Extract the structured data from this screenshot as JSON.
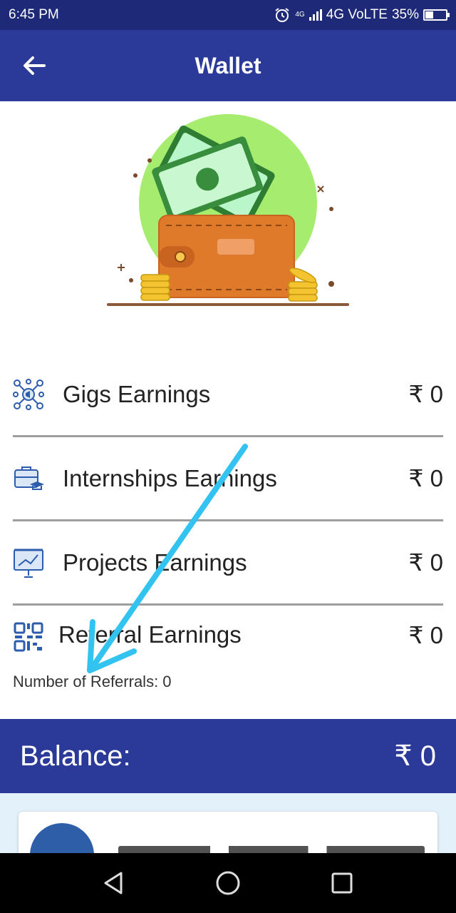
{
  "status": {
    "time": "6:45 PM",
    "net_top": "4G",
    "network": "4G VoLTE",
    "battery": "35%",
    "battery_level": 0.35
  },
  "header": {
    "title": "Wallet",
    "back_icon": "arrow-left-icon"
  },
  "earnings": [
    {
      "label": "Gigs Earnings",
      "amount": "₹ 0",
      "icon": "network-megaphone-icon"
    },
    {
      "label": "Internships Earnings",
      "amount": "₹ 0",
      "icon": "briefcase-graduate-icon"
    },
    {
      "label": "Projects Earnings",
      "amount": "₹ 0",
      "icon": "presentation-board-icon"
    },
    {
      "label": "Referral Earnings",
      "amount": "₹ 0",
      "icon": "qr-code-icon"
    }
  ],
  "referrals": {
    "label": "Number of Referrals:  0"
  },
  "balance": {
    "label": "Balance:",
    "amount": "₹ 0"
  },
  "colors": {
    "primary": "#2b3a99",
    "status_bar": "#1e2a78",
    "annotation_arrow": "#33c3f0"
  }
}
